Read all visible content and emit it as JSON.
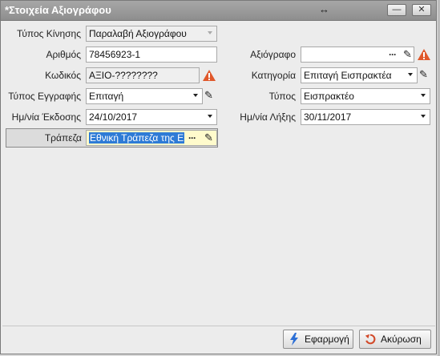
{
  "window": {
    "title": "*Στοιχεία Αξιογράφου",
    "resize_glyph": "↔",
    "minimize_glyph": "—",
    "close_glyph": "✕"
  },
  "form": {
    "movement_type": {
      "label": "Τύπος Κίνησης",
      "value": "Παραλαβή Αξιογράφου"
    },
    "number": {
      "label": "Αριθμός",
      "value": "78456923-1"
    },
    "code": {
      "label": "Κωδικός",
      "value": "ΑΞΙΟ-????????"
    },
    "entry_type": {
      "label": "Τύπος Εγγραφής",
      "value": "Επιταγή"
    },
    "issue_date": {
      "label": "Ημ/νία Έκδοσης",
      "value": "24/10/2017"
    },
    "bank": {
      "label": "Τράπεζα",
      "value": "Εθνική Τράπεζα της Ε"
    },
    "cheque": {
      "label": "Αξιόγραφο",
      "value": ""
    },
    "category": {
      "label": "Κατηγορία",
      "value": "Επιταγή Εισπρακτέα"
    },
    "type": {
      "label": "Τύπος",
      "value": "Εισπρακτέο"
    },
    "due_date": {
      "label": "Ημ/νία Λήξης",
      "value": "30/11/2017"
    },
    "dots_glyph": "···",
    "pencil_glyph": "✎"
  },
  "footer": {
    "apply_label": "Εφαρμογή",
    "cancel_label": "Ακύρωση"
  },
  "colors": {
    "warning": "#e0582b",
    "selection": "#2e7bd6",
    "apply_icon": "#2c6fd6",
    "cancel_icon": "#d24a2a"
  }
}
